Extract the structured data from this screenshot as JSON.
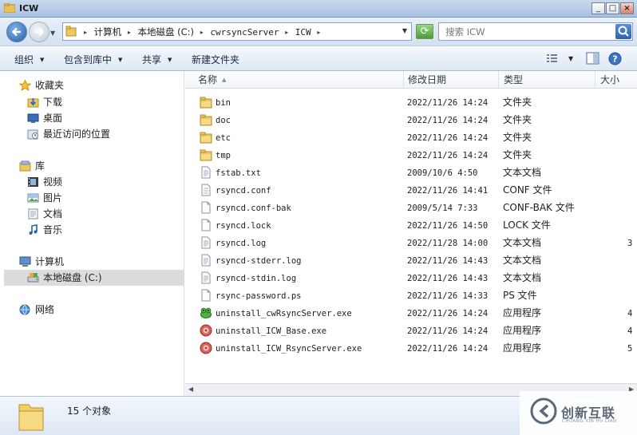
{
  "window": {
    "title": "ICW",
    "minimize_icon": "_",
    "maximize_icon": "□",
    "close_icon": "×"
  },
  "address": {
    "crumbs": [
      "计算机",
      "本地磁盘 (C:)",
      "cwrsyncServer",
      "ICW"
    ],
    "search_placeholder": "搜索 ICW"
  },
  "toolbar": {
    "organize": "组织",
    "include_in_library": "包含到库中",
    "share": "共享",
    "new_folder": "新建文件夹"
  },
  "navpane": {
    "favorites": "收藏夹",
    "downloads": "下载",
    "desktop": "桌面",
    "recent": "最近访问的位置",
    "libraries": "库",
    "videos": "视频",
    "pictures": "图片",
    "documents": "文档",
    "music": "音乐",
    "computer": "计算机",
    "local_disk": "本地磁盘 (C:)",
    "network": "网络"
  },
  "columns": {
    "name": "名称",
    "date": "修改日期",
    "type": "类型",
    "size": "大小"
  },
  "files": [
    {
      "name": "bin",
      "date": "2022/11/26 14:24",
      "type": "文件夹",
      "size": "",
      "icon": "folder-icon"
    },
    {
      "name": "doc",
      "date": "2022/11/26 14:24",
      "type": "文件夹",
      "size": "",
      "icon": "folder-icon"
    },
    {
      "name": "etc",
      "date": "2022/11/26 14:24",
      "type": "文件夹",
      "size": "",
      "icon": "folder-icon"
    },
    {
      "name": "tmp",
      "date": "2022/11/26 14:24",
      "type": "文件夹",
      "size": "",
      "icon": "folder-icon"
    },
    {
      "name": "fstab.txt",
      "date": "2009/10/6 4:50",
      "type": "文本文档",
      "size": "",
      "icon": "text-file-icon"
    },
    {
      "name": "rsyncd.conf",
      "date": "2022/11/26 14:41",
      "type": "CONF 文件",
      "size": "",
      "icon": "conf-file-icon"
    },
    {
      "name": "rsyncd.conf-bak",
      "date": "2009/5/14 7:33",
      "type": "CONF-BAK 文件",
      "size": "",
      "icon": "file-icon"
    },
    {
      "name": "rsyncd.lock",
      "date": "2022/11/26 14:50",
      "type": "LOCK 文件",
      "size": "",
      "icon": "file-icon"
    },
    {
      "name": "rsyncd.log",
      "date": "2022/11/28 14:00",
      "type": "文本文档",
      "size": "3",
      "icon": "text-file-icon"
    },
    {
      "name": "rsyncd-stderr.log",
      "date": "2022/11/26 14:43",
      "type": "文本文档",
      "size": "",
      "icon": "text-file-icon"
    },
    {
      "name": "rsyncd-stdin.log",
      "date": "2022/11/26 14:43",
      "type": "文本文档",
      "size": "",
      "icon": "text-file-icon"
    },
    {
      "name": "rsync-password.ps",
      "date": "2022/11/26 14:33",
      "type": "PS 文件",
      "size": "",
      "icon": "file-icon"
    },
    {
      "name": "uninstall_cwRsyncServer.exe",
      "date": "2022/11/26 14:24",
      "type": "应用程序",
      "size": "4",
      "icon": "frog-exe-icon"
    },
    {
      "name": "uninstall_ICW_Base.exe",
      "date": "2022/11/26 14:24",
      "type": "应用程序",
      "size": "4",
      "icon": "red-exe-icon"
    },
    {
      "name": "uninstall_ICW_RsyncServer.exe",
      "date": "2022/11/26 14:24",
      "type": "应用程序",
      "size": "5",
      "icon": "red-exe-icon"
    }
  ],
  "status": {
    "count": "15 个对象"
  },
  "watermark": {
    "text": "创新互联",
    "sub": "CHUANG XIN HU LIAN"
  }
}
